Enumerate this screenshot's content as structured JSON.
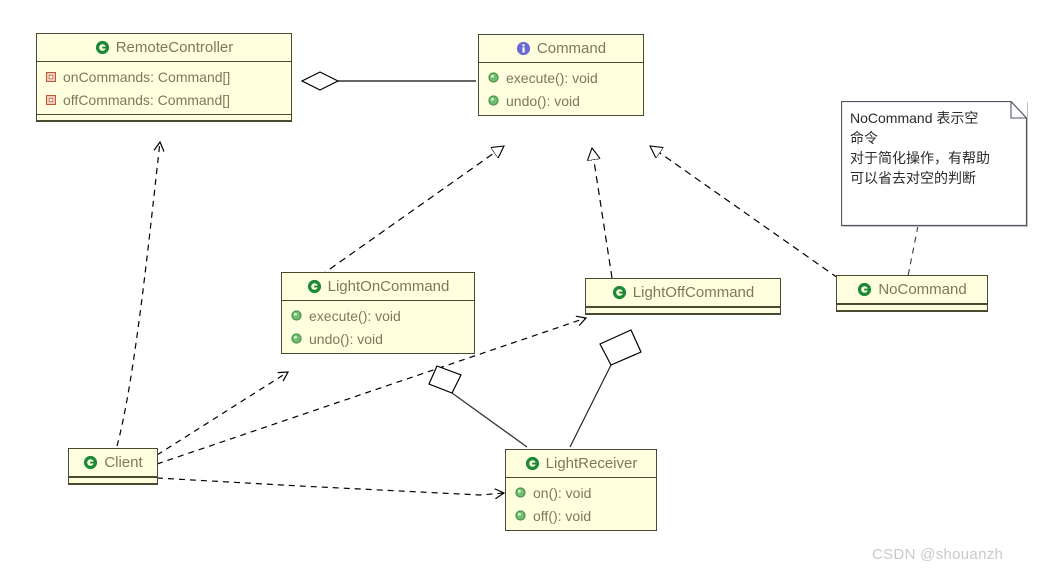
{
  "diagram": {
    "title": "Command Pattern UML Class Diagram",
    "background_color": "#ffffff",
    "class_fill_color": "#ffffe0",
    "class_border_color": "#4a4a32",
    "class_text_color": "#7a7a55",
    "class_icon_color": "#1e8a38",
    "interface_icon_color": "#6a6ad0",
    "field_icon_color": "#c06a4a",
    "method_icon_color": "#4aa94a",
    "note_text_color": "#2b2b2b"
  },
  "classes": {
    "remote_controller": {
      "name": "RemoteController",
      "icon": "class-icon",
      "stereotype": "class",
      "members": [
        {
          "label": "onCommands: Command[]",
          "icon": "field-icon"
        },
        {
          "label": "offCommands: Command[]",
          "icon": "field-icon"
        }
      ]
    },
    "command": {
      "name": "Command",
      "icon": "interface-icon",
      "stereotype": "interface",
      "members": [
        {
          "label": "execute(): void",
          "icon": "method-icon"
        },
        {
          "label": "undo(): void",
          "icon": "method-icon"
        }
      ]
    },
    "light_on_command": {
      "name": "LightOnCommand",
      "icon": "class-icon",
      "stereotype": "class",
      "members": [
        {
          "label": "execute(): void",
          "icon": "method-icon"
        },
        {
          "label": "undo(): void",
          "icon": "method-icon"
        }
      ]
    },
    "light_off_command": {
      "name": "LightOffCommand",
      "icon": "class-icon",
      "stereotype": "class",
      "members": []
    },
    "no_command": {
      "name": "NoCommand",
      "icon": "class-icon",
      "stereotype": "class",
      "members": []
    },
    "client": {
      "name": "Client",
      "icon": "class-icon",
      "stereotype": "class",
      "members": []
    },
    "light_receiver": {
      "name": "LightReceiver",
      "icon": "class-icon",
      "stereotype": "class",
      "members": [
        {
          "label": "on(): void",
          "icon": "method-icon"
        },
        {
          "label": "off(): void",
          "icon": "method-icon"
        }
      ]
    }
  },
  "note": {
    "lines": [
      "NoCommand 表示空",
      "命令",
      "对于简化操作，有帮助",
      "可以省去对空的判断"
    ]
  },
  "relationships": [
    {
      "from": "RemoteController",
      "to": "Command",
      "type": "aggregation"
    },
    {
      "from": "LightOnCommand",
      "to": "Command",
      "type": "realization"
    },
    {
      "from": "LightOffCommand",
      "to": "Command",
      "type": "realization"
    },
    {
      "from": "NoCommand",
      "to": "Command",
      "type": "realization"
    },
    {
      "from": "Client",
      "to": "RemoteController",
      "type": "dependency"
    },
    {
      "from": "Client",
      "to": "LightOnCommand",
      "type": "dependency"
    },
    {
      "from": "Client",
      "to": "LightOffCommand",
      "type": "dependency"
    },
    {
      "from": "Client",
      "to": "LightReceiver",
      "type": "dependency"
    },
    {
      "from": "LightOnCommand",
      "to": "LightReceiver",
      "type": "aggregation"
    },
    {
      "from": "LightOffCommand",
      "to": "LightReceiver",
      "type": "aggregation"
    },
    {
      "from": "Note",
      "to": "NoCommand",
      "type": "note-anchor"
    }
  ],
  "watermark": {
    "text": "CSDN @shouanzh"
  }
}
